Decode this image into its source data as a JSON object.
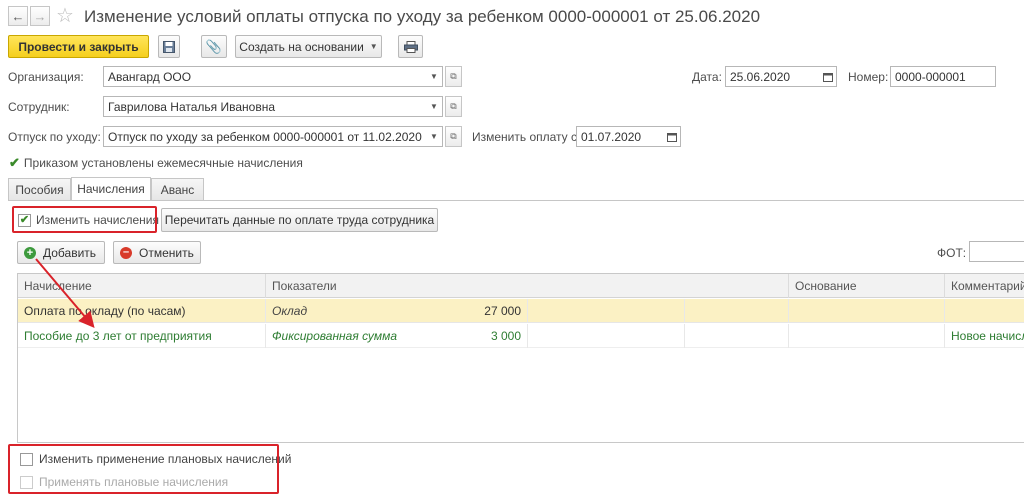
{
  "header": {
    "title": "Изменение условий оплаты отпуска по уходу за ребенком 0000-000001 от 25.06.2020"
  },
  "toolbar": {
    "post_close": "Провести и закрыть",
    "create_based": "Создать на основании"
  },
  "form": {
    "org_label": "Организация:",
    "org_value": "Авангард ООО",
    "date_label": "Дата:",
    "date_value": "25.06.2020",
    "number_label": "Номер:",
    "number_value": "0000-000001",
    "employee_label": "Сотрудник:",
    "employee_value": "Гаврилова Наталья Ивановна",
    "leave_label": "Отпуск по уходу:",
    "leave_value": "Отпуск по уходу за ребенком 0000-000001 от 11.02.2020",
    "change_from_label": "Изменить оплату с:",
    "change_from_value": "01.07.2020",
    "monthly_accruals_label": "Приказом установлены ежемесячные начисления",
    "monthly_accruals_checked": true
  },
  "tabs": [
    {
      "label": "Пособия"
    },
    {
      "label": "Начисления",
      "active": true
    },
    {
      "label": "Аванс"
    }
  ],
  "accruals": {
    "change_label": "Изменить начисления",
    "change_checked": true,
    "reread_button": "Перечитать данные по оплате труда сотрудника",
    "add_button": "Добавить",
    "cancel_button": "Отменить",
    "fot_label": "ФОТ:",
    "columns": [
      "Начисление",
      "Показатели",
      "Основание",
      "Комментарий"
    ],
    "rows": [
      {
        "accrual": "Оплата по окладу (по часам)",
        "indicator": "Оклад",
        "amount": "27 000",
        "basis": "",
        "comment": ""
      },
      {
        "accrual": "Пособие до 3 лет от предприятия",
        "indicator": "Фиксированная сумма",
        "amount": "3 000",
        "basis": "",
        "comment": "Новое начисл"
      }
    ]
  },
  "bottom": {
    "planned_change_label": "Изменить применение плановых начислений",
    "planned_apply_label": "Применять плановые начисления"
  },
  "colors": {
    "accent_yellow": "#f5cf1e",
    "highlight_row": "#fbf1c4",
    "green_text": "#2e7d32",
    "annotation_red": "#d9232a"
  }
}
